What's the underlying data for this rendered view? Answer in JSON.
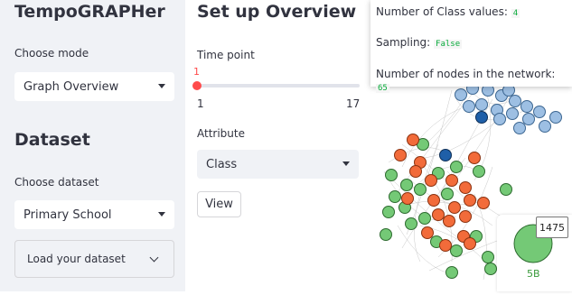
{
  "sidebar": {
    "app_title": "TempoGRAPHer",
    "mode_label": "Choose mode",
    "mode_value": "Graph Overview",
    "dataset_heading": "Dataset",
    "dataset_label": "Choose dataset",
    "dataset_value": "Primary School",
    "load_label": "Load your dataset"
  },
  "main": {
    "heading": "Set up Overview",
    "timepoint_label": "Time point",
    "timepoint_value": "1",
    "slider_min": "1",
    "slider_max": "17",
    "slider_fraction": 0,
    "attribute_label": "Attribute",
    "attribute_value": "Class",
    "view_button": "View"
  },
  "info": {
    "class_values_label": "Number of Class values:",
    "class_values": "4",
    "sampling_label": "Sampling:",
    "sampling_value": "False",
    "nodes_label": "Number of nodes in the network:",
    "nodes_value": "65"
  },
  "graph": {
    "tooltip": "1475",
    "zoom_node_label": "5B",
    "colors": {
      "light_blue": "#9dbfe3",
      "dark_blue": "#1f5fa8",
      "green": "#74c976",
      "orange": "#f26b3a"
    }
  },
  "icons": {
    "select_caret": "caret-down-icon",
    "expander": "chevron-down-icon"
  }
}
